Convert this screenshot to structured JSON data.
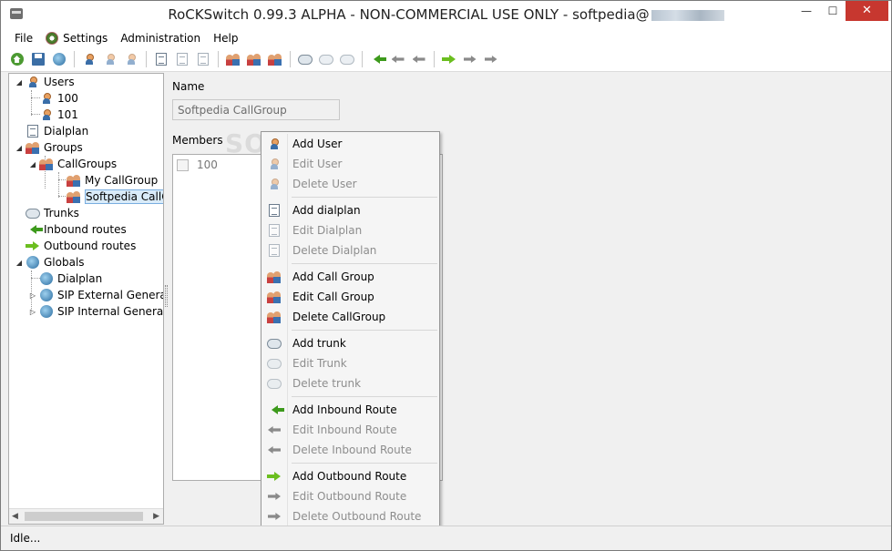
{
  "window": {
    "title": "RoCKSwitch 0.99.3 ALPHA - NON-COMMERCIAL USE ONLY - softpedia@",
    "minimize_icon": "minimize-icon",
    "maximize_icon": "maximize-icon",
    "close_icon": "close-icon",
    "minimize_glyph": "—",
    "maximize_glyph": "☐",
    "close_glyph": "✕"
  },
  "menu": {
    "file": "File",
    "settings": "Settings",
    "administration": "Administration",
    "help": "Help"
  },
  "toolbar": {
    "icons": [
      "globe-connect-icon",
      "save-icon",
      "globe-web-icon",
      "add-user-icon",
      "edit-user-icon",
      "delete-user-icon",
      "add-dialplan-icon",
      "edit-dialplan-icon",
      "delete-dialplan-icon",
      "add-callgroup-icon",
      "edit-callgroup-icon",
      "delete-callgroup-icon",
      "add-trunk-icon",
      "edit-trunk-icon",
      "delete-trunk-icon",
      "add-inbound-route-icon",
      "edit-inbound-route-icon",
      "delete-inbound-route-icon",
      "add-outbound-route-icon",
      "edit-outbound-route-icon",
      "delete-outbound-route-icon"
    ]
  },
  "tree": {
    "users": "Users",
    "user_100": "100",
    "user_101": "101",
    "dialplan": "Dialplan",
    "groups": "Groups",
    "callgroups": "CallGroups",
    "my_callgroup": "My CallGroup",
    "softpedia_callgroup": "Softpedia CallGrou",
    "trunks": "Trunks",
    "inbound_routes": "Inbound routes",
    "outbound_routes": "Outbound routes",
    "globals": "Globals",
    "globals_dialplan": "Dialplan",
    "sip_external": "SIP External General",
    "sip_internal": "SIP Internal General",
    "scroll_left": "◀",
    "scroll_right": "▶"
  },
  "form": {
    "name_label": "Name",
    "name_value": "Softpedia CallGroup",
    "members_label": "Members",
    "members": [
      {
        "label": "100",
        "checked": false
      }
    ]
  },
  "watermark": "SOFTPEDIA",
  "context_menu": {
    "add_user": "Add User",
    "edit_user": "Edit User",
    "delete_user": "Delete User",
    "add_dialplan": "Add dialplan",
    "edit_dialplan": "Edit Dialplan",
    "delete_dialplan": "Delete Dialplan",
    "add_call_group": "Add Call Group",
    "edit_call_group": "Edit Call Group",
    "delete_callgroup": "Delete CallGroup",
    "add_trunk": "Add trunk",
    "edit_trunk": "Edit Trunk",
    "delete_trunk": "Delete trunk",
    "add_inbound": "Add Inbound Route",
    "edit_inbound": "Edit Inbound Route",
    "delete_inbound": "Delete Inbound Route",
    "add_outbound": "Add Outbound Route",
    "edit_outbound": "Edit Outbound Route",
    "delete_outbound": "Delete Outbound Route"
  },
  "status": {
    "text": "Idle..."
  },
  "colors": {
    "close_button": "#c7372f",
    "selection": "#d9ebf9",
    "disabled_text": "#8d8d8d",
    "inbound_green": "#3d9a1c",
    "outbound_green": "#6bbe1f"
  }
}
